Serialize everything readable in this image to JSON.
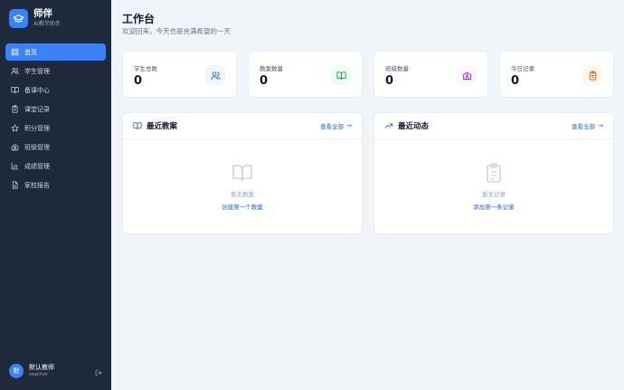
{
  "sidebar": {
    "brand_title": "师伴",
    "brand_subtitle": "AI教学助手",
    "items": [
      {
        "label": "首页",
        "icon": "dashboard-icon",
        "active": true
      },
      {
        "label": "学生管理",
        "icon": "users-icon"
      },
      {
        "label": "备课中心",
        "icon": "book-icon"
      },
      {
        "label": "课堂记录",
        "icon": "clipboard-icon"
      },
      {
        "label": "积分管理",
        "icon": "star-icon"
      },
      {
        "label": "班级管理",
        "icon": "school-icon"
      },
      {
        "label": "成绩管理",
        "icon": "bar-chart-icon"
      },
      {
        "label": "家校报告",
        "icon": "document-icon"
      }
    ],
    "user": {
      "avatar": "默",
      "name": "默认教师",
      "role": "teacher"
    }
  },
  "header": {
    "title": "工作台",
    "subtitle": "欢迎回来，今天也是充满希望的一天"
  },
  "stats": [
    {
      "label": "学生总数",
      "value": "0",
      "icon": "users-icon",
      "color": "#2563eb",
      "bg": "#eff6ff"
    },
    {
      "label": "教案数量",
      "value": "0",
      "icon": "book-icon",
      "color": "#16a34a",
      "bg": "#ecfdf5"
    },
    {
      "label": "班级数量",
      "value": "0",
      "icon": "school-icon",
      "color": "#9333ea",
      "bg": "#faf5ff"
    },
    {
      "label": "今日记录",
      "value": "0",
      "icon": "clipboard-icon",
      "color": "#ea580c",
      "bg": "#fff7ed"
    }
  ],
  "panels": {
    "lessons": {
      "title": "最近教案",
      "link": "查看全部",
      "empty_text": "暂无教案",
      "empty_action": "创建第一个教案"
    },
    "activity": {
      "title": "最近动态",
      "link": "查看全部",
      "empty_text": "暂无记录",
      "empty_action": "添加第一条记录"
    }
  },
  "colors": {
    "sidebar_bg": "#1e293b",
    "accent": "#3b82f6",
    "link": "#2563eb"
  }
}
